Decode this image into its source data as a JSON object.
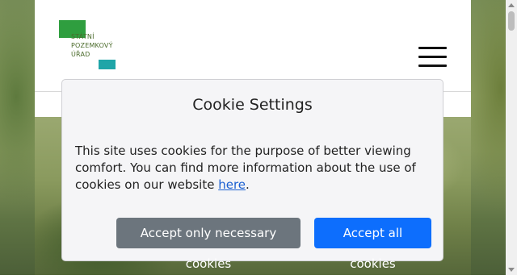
{
  "logo": {
    "lines": [
      "STÁTNÍ",
      "POZEMKOVÝ",
      "ÚŘAD"
    ],
    "colors": {
      "green": "#2f9e3f",
      "teal": "#1fa5a8"
    }
  },
  "header": {
    "menu_icon": "hamburger-menu-icon"
  },
  "cookie_modal": {
    "title": "Cookie Settings",
    "text_before_link": "This site uses cookies for the purpose of better viewing comfort. You can find more information about the use of cookies on our website ",
    "link_text": "here",
    "text_after_link": ".",
    "buttons": {
      "necessary": "Accept only necessary cookies",
      "all": "Accept all cookies"
    },
    "colors": {
      "necessary": "#6c757d",
      "all": "#0d6efd",
      "link": "#1a5fd1"
    }
  }
}
